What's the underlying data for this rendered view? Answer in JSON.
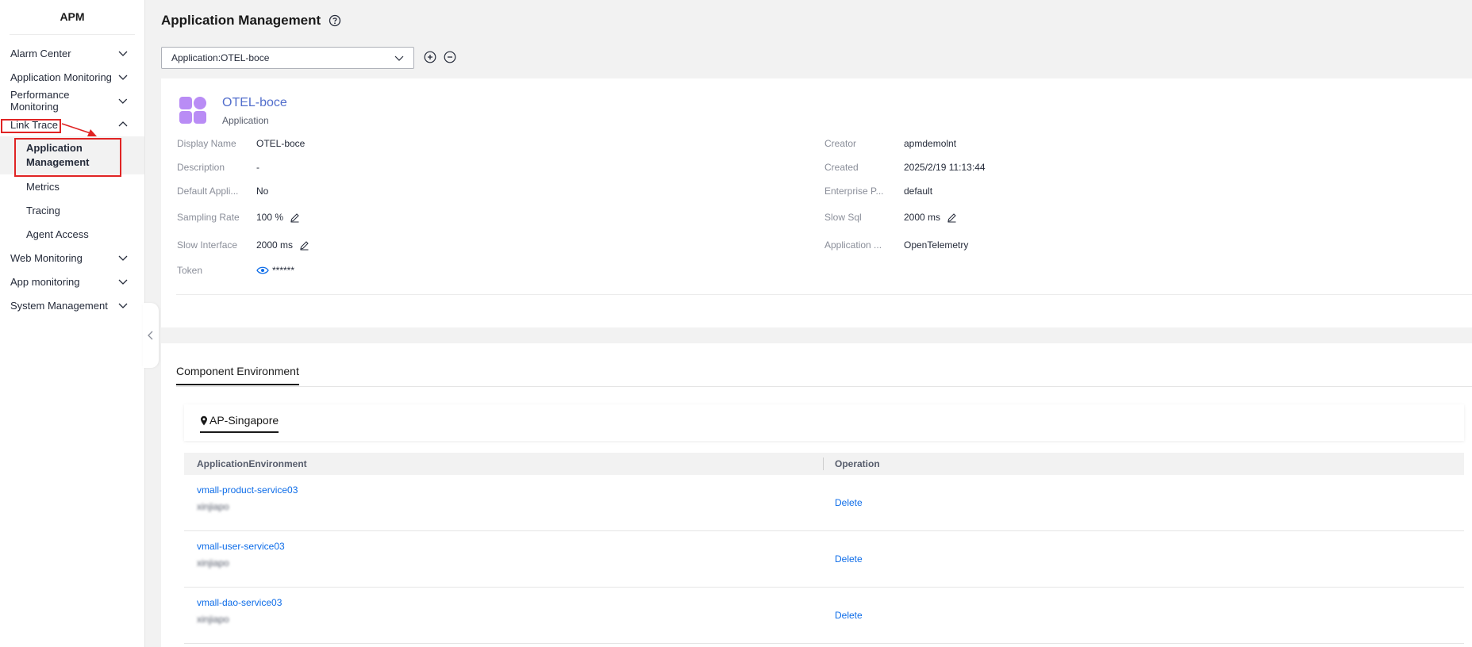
{
  "sidebar": {
    "title": "APM",
    "items": [
      {
        "label": "Alarm Center"
      },
      {
        "label": "Application Monitoring"
      },
      {
        "label": "Performance Monitoring"
      },
      {
        "label": "Link Trace"
      },
      {
        "label": "Web Monitoring"
      },
      {
        "label": "App monitoring"
      },
      {
        "label": "System Management"
      }
    ],
    "link_trace_children": [
      {
        "label_line1": "Application",
        "label_line2": "Management"
      },
      {
        "label": "Metrics"
      },
      {
        "label": "Tracing"
      },
      {
        "label": "Agent Access"
      }
    ]
  },
  "header": {
    "title": "Application Management"
  },
  "selector": {
    "value": "Application:OTEL-boce"
  },
  "app": {
    "name": "OTEL-boce",
    "type": "Application",
    "fields_left": [
      {
        "key": "Display Name",
        "value": "OTEL-boce"
      },
      {
        "key": "Description",
        "value": "-"
      },
      {
        "key": "Default Appli...",
        "value": "No"
      },
      {
        "key": "Sampling Rate",
        "value": "100 %"
      },
      {
        "key": "Slow Interface",
        "value": "2000 ms"
      },
      {
        "key": "Token",
        "value": "******"
      }
    ],
    "fields_right": [
      {
        "key": "Creator",
        "value": "apmdemolnt"
      },
      {
        "key": "Created",
        "value": "2025/2/19 11:13:44"
      },
      {
        "key": "Enterprise P...",
        "value": "default"
      },
      {
        "key": "Slow Sql",
        "value": "2000 ms"
      },
      {
        "key": "Application ...",
        "value": "OpenTelemetry"
      }
    ]
  },
  "component_env": {
    "tab_label": "Component Environment",
    "region": "AP-Singapore",
    "columns": [
      "ApplicationEnvironment",
      "Operation"
    ],
    "rows": [
      {
        "name": "vmall-product-service03",
        "sub": "xinjiapo",
        "op": "Delete"
      },
      {
        "name": "vmall-user-service03",
        "sub": "xinjiapo",
        "op": "Delete"
      },
      {
        "name": "vmall-dao-service03",
        "sub": "xinjiapo",
        "op": "Delete"
      }
    ]
  },
  "colors": {
    "link": "#0d6ce8",
    "app_name": "#526ecc",
    "highlight": "#e02424",
    "logo": "#b98cf5"
  }
}
